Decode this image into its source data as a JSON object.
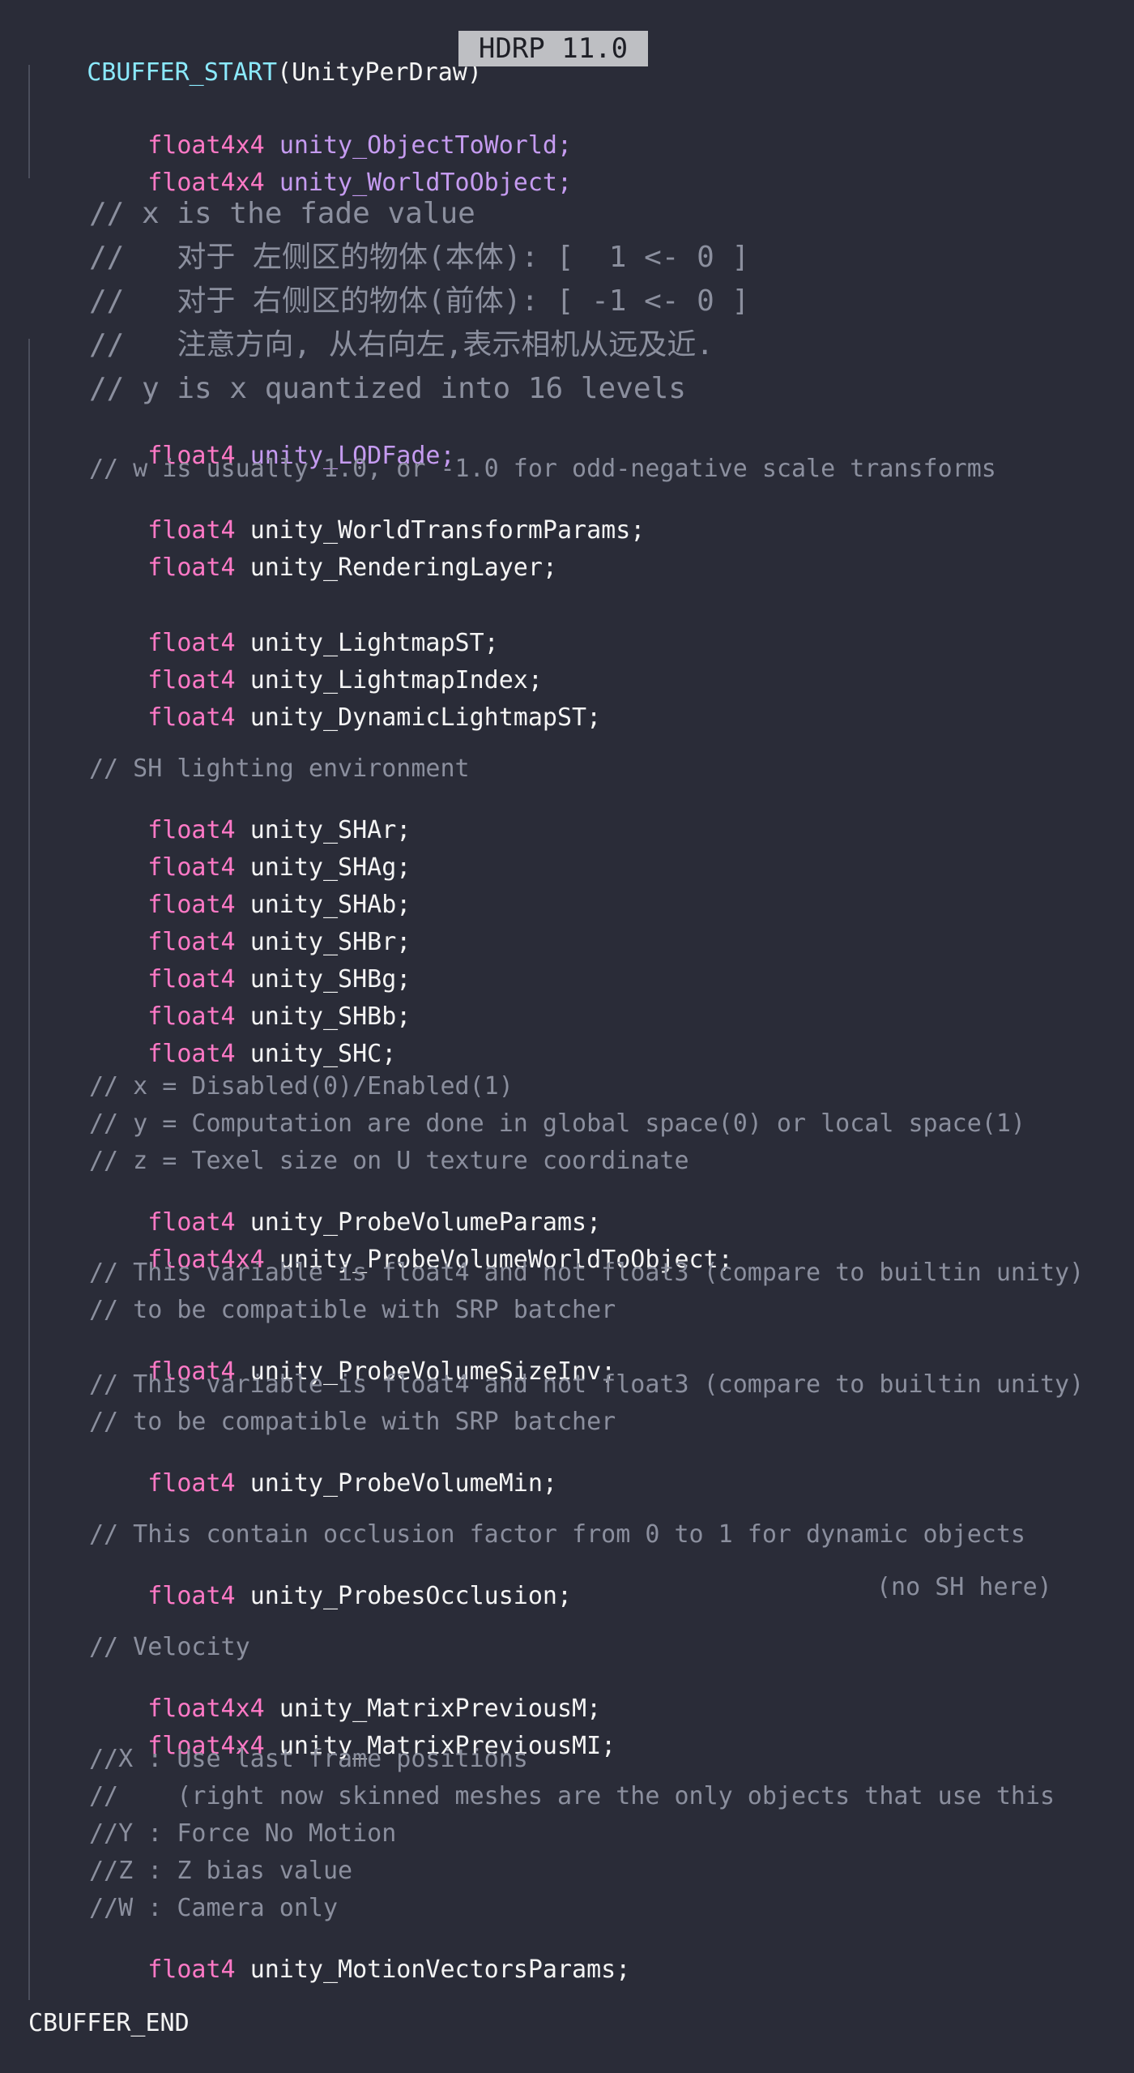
{
  "header": {
    "macro": "CBUFFER_START",
    "args": "(UnityPerDraw)",
    "badge": "HDRP 11.0"
  },
  "footer": {
    "text": "CBUFFER_END"
  },
  "code": {
    "object_to_world": {
      "type": "float4x4",
      "name": "unity_ObjectToWorld;"
    },
    "world_to_object": {
      "type": "float4x4",
      "name": "unity_WorldToObject;"
    },
    "fade_comment": [
      "// x is the fade value",
      "//   对于 左侧区的物体(本体): [  1 <- 0 ]",
      "//   对于 右侧区的物体(前体): [ -1 <- 0 ]",
      "//   注意方向, 从右向左,表示相机从远及近.",
      "// y is x quantized into 16 levels"
    ],
    "lod_fade": {
      "type": "float4",
      "name": "unity_LODFade;"
    },
    "w_comment": "// w is usually 1.0, or -1.0 for odd-negative scale transforms",
    "world_transform_params": {
      "type": "float4",
      "name": "unity_WorldTransformParams;"
    },
    "rendering_layer": {
      "type": "float4",
      "name": "unity_RenderingLayer;"
    },
    "lightmap_st": {
      "type": "float4",
      "name": "unity_LightmapST;"
    },
    "lightmap_index": {
      "type": "float4",
      "name": "unity_LightmapIndex;"
    },
    "dynamic_lightmap_st": {
      "type": "float4",
      "name": "unity_DynamicLightmapST;"
    },
    "sh_comment": "// SH lighting environment",
    "sh_vars": [
      {
        "type": "float4",
        "name": "unity_SHAr;"
      },
      {
        "type": "float4",
        "name": "unity_SHAg;"
      },
      {
        "type": "float4",
        "name": "unity_SHAb;"
      },
      {
        "type": "float4",
        "name": "unity_SHBr;"
      },
      {
        "type": "float4",
        "name": "unity_SHBg;"
      },
      {
        "type": "float4",
        "name": "unity_SHBb;"
      },
      {
        "type": "float4",
        "name": "unity_SHC;"
      }
    ],
    "probe_params_comment": [
      "// x = Disabled(0)/Enabled(1)",
      "// y = Computation are done in global space(0) or local space(1)",
      "// z = Texel size on U texture coordinate"
    ],
    "probe_volume_params": {
      "type": "float4",
      "name": "unity_ProbeVolumeParams;"
    },
    "probe_volume_world_to_object": {
      "type": "float4x4",
      "name": "unity_ProbeVolumeWorldToObject;"
    },
    "size_inv_comment": [
      "// This variable is float4 and not float3 (compare to builtin unity)",
      "// to be compatible with SRP batcher"
    ],
    "probe_volume_size_inv": {
      "type": "float4",
      "name": "unity_ProbeVolumeSizeInv;"
    },
    "min_comment": [
      "// This variable is float4 and not float3 (compare to builtin unity)",
      "// to be compatible with SRP batcher"
    ],
    "probe_volume_min": {
      "type": "float4",
      "name": "unity_ProbeVolumeMin;"
    },
    "occlusion_comment": "// This contain occlusion factor from 0 to 1 for dynamic objects",
    "probes_occlusion": {
      "type": "float4",
      "name": "unity_ProbesOcclusion;"
    },
    "occlusion_note": "(no SH here)",
    "velocity_comment": "// Velocity",
    "matrix_previous_m": {
      "type": "float4x4",
      "name": "unity_MatrixPreviousM;"
    },
    "matrix_previous_mi": {
      "type": "float4x4",
      "name": "unity_MatrixPreviousMI;"
    },
    "motion_comment": [
      "//X : Use last frame positions",
      "//    (right now skinned meshes are the only objects that use this",
      "//Y : Force No Motion",
      "//Z : Z bias value",
      "//W : Camera only"
    ],
    "motion_vectors_params": {
      "type": "float4",
      "name": "unity_MotionVectorsParams;"
    }
  },
  "colors": {
    "background": "#2a2c38",
    "macro": "#8be9fd",
    "type": "#ff79c6",
    "purple_var": "#c59bf0",
    "comment": "#8b8f9e",
    "text": "#f4f4f4",
    "badge_bg": "#bebfc3"
  }
}
